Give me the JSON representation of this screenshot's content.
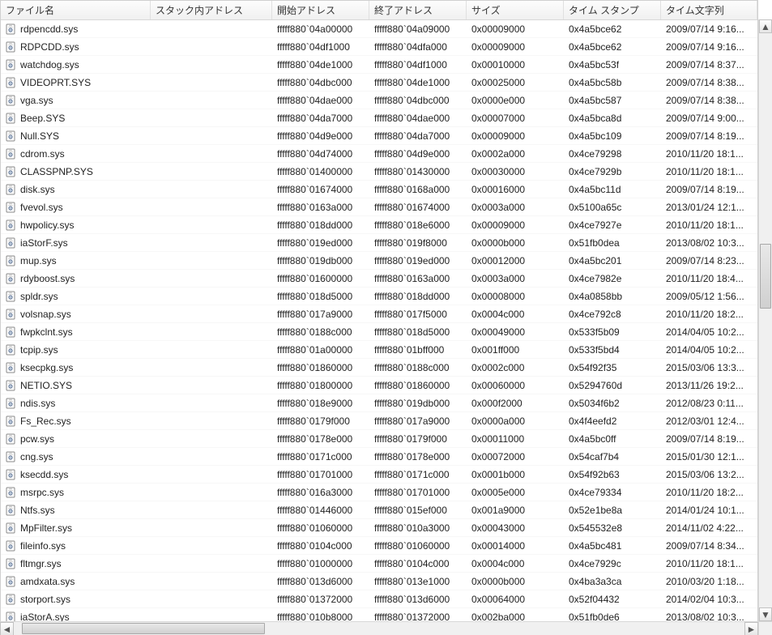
{
  "columns": [
    "ファイル名",
    "スタック内アドレス",
    "開始アドレス",
    "終了アドレス",
    "サイズ",
    "タイム スタンプ",
    "タイム文字列"
  ],
  "rows": [
    {
      "file": "rdpencdd.sys",
      "stack": "",
      "start": "fffff880`04a00000",
      "end": "fffff880`04a09000",
      "size": "0x00009000",
      "ts": "0x4a5bce62",
      "tstr": "2009/07/14 9:16..."
    },
    {
      "file": "RDPCDD.sys",
      "stack": "",
      "start": "fffff880`04df1000",
      "end": "fffff880`04dfa000",
      "size": "0x00009000",
      "ts": "0x4a5bce62",
      "tstr": "2009/07/14 9:16..."
    },
    {
      "file": "watchdog.sys",
      "stack": "",
      "start": "fffff880`04de1000",
      "end": "fffff880`04df1000",
      "size": "0x00010000",
      "ts": "0x4a5bc53f",
      "tstr": "2009/07/14 8:37..."
    },
    {
      "file": "VIDEOPRT.SYS",
      "stack": "",
      "start": "fffff880`04dbc000",
      "end": "fffff880`04de1000",
      "size": "0x00025000",
      "ts": "0x4a5bc58b",
      "tstr": "2009/07/14 8:38..."
    },
    {
      "file": "vga.sys",
      "stack": "",
      "start": "fffff880`04dae000",
      "end": "fffff880`04dbc000",
      "size": "0x0000e000",
      "ts": "0x4a5bc587",
      "tstr": "2009/07/14 8:38..."
    },
    {
      "file": "Beep.SYS",
      "stack": "",
      "start": "fffff880`04da7000",
      "end": "fffff880`04dae000",
      "size": "0x00007000",
      "ts": "0x4a5bca8d",
      "tstr": "2009/07/14 9:00..."
    },
    {
      "file": "Null.SYS",
      "stack": "",
      "start": "fffff880`04d9e000",
      "end": "fffff880`04da7000",
      "size": "0x00009000",
      "ts": "0x4a5bc109",
      "tstr": "2009/07/14 8:19..."
    },
    {
      "file": "cdrom.sys",
      "stack": "",
      "start": "fffff880`04d74000",
      "end": "fffff880`04d9e000",
      "size": "0x0002a000",
      "ts": "0x4ce79298",
      "tstr": "2010/11/20 18:1..."
    },
    {
      "file": "CLASSPNP.SYS",
      "stack": "",
      "start": "fffff880`01400000",
      "end": "fffff880`01430000",
      "size": "0x00030000",
      "ts": "0x4ce7929b",
      "tstr": "2010/11/20 18:1..."
    },
    {
      "file": "disk.sys",
      "stack": "",
      "start": "fffff880`01674000",
      "end": "fffff880`0168a000",
      "size": "0x00016000",
      "ts": "0x4a5bc11d",
      "tstr": "2009/07/14 8:19..."
    },
    {
      "file": "fvevol.sys",
      "stack": "",
      "start": "fffff880`0163a000",
      "end": "fffff880`01674000",
      "size": "0x0003a000",
      "ts": "0x5100a65c",
      "tstr": "2013/01/24 12:1..."
    },
    {
      "file": "hwpolicy.sys",
      "stack": "",
      "start": "fffff880`018dd000",
      "end": "fffff880`018e6000",
      "size": "0x00009000",
      "ts": "0x4ce7927e",
      "tstr": "2010/11/20 18:1..."
    },
    {
      "file": "iaStorF.sys",
      "stack": "",
      "start": "fffff880`019ed000",
      "end": "fffff880`019f8000",
      "size": "0x0000b000",
      "ts": "0x51fb0dea",
      "tstr": "2013/08/02 10:3..."
    },
    {
      "file": "mup.sys",
      "stack": "",
      "start": "fffff880`019db000",
      "end": "fffff880`019ed000",
      "size": "0x00012000",
      "ts": "0x4a5bc201",
      "tstr": "2009/07/14 8:23..."
    },
    {
      "file": "rdyboost.sys",
      "stack": "",
      "start": "fffff880`01600000",
      "end": "fffff880`0163a000",
      "size": "0x0003a000",
      "ts": "0x4ce7982e",
      "tstr": "2010/11/20 18:4..."
    },
    {
      "file": "spldr.sys",
      "stack": "",
      "start": "fffff880`018d5000",
      "end": "fffff880`018dd000",
      "size": "0x00008000",
      "ts": "0x4a0858bb",
      "tstr": "2009/05/12 1:56..."
    },
    {
      "file": "volsnap.sys",
      "stack": "",
      "start": "fffff880`017a9000",
      "end": "fffff880`017f5000",
      "size": "0x0004c000",
      "ts": "0x4ce792c8",
      "tstr": "2010/11/20 18:2..."
    },
    {
      "file": "fwpkclnt.sys",
      "stack": "",
      "start": "fffff880`0188c000",
      "end": "fffff880`018d5000",
      "size": "0x00049000",
      "ts": "0x533f5b09",
      "tstr": "2014/04/05 10:2..."
    },
    {
      "file": "tcpip.sys",
      "stack": "",
      "start": "fffff880`01a00000",
      "end": "fffff880`01bff000",
      "size": "0x001ff000",
      "ts": "0x533f5bd4",
      "tstr": "2014/04/05 10:2..."
    },
    {
      "file": "ksecpkg.sys",
      "stack": "",
      "start": "fffff880`01860000",
      "end": "fffff880`0188c000",
      "size": "0x0002c000",
      "ts": "0x54f92f35",
      "tstr": "2015/03/06 13:3..."
    },
    {
      "file": "NETIO.SYS",
      "stack": "",
      "start": "fffff880`01800000",
      "end": "fffff880`01860000",
      "size": "0x00060000",
      "ts": "0x5294760d",
      "tstr": "2013/11/26 19:2..."
    },
    {
      "file": "ndis.sys",
      "stack": "",
      "start": "fffff880`018e9000",
      "end": "fffff880`019db000",
      "size": "0x000f2000",
      "ts": "0x5034f6b2",
      "tstr": "2012/08/23 0:11..."
    },
    {
      "file": "Fs_Rec.sys",
      "stack": "",
      "start": "fffff880`0179f000",
      "end": "fffff880`017a9000",
      "size": "0x0000a000",
      "ts": "0x4f4eefd2",
      "tstr": "2012/03/01 12:4..."
    },
    {
      "file": "pcw.sys",
      "stack": "",
      "start": "fffff880`0178e000",
      "end": "fffff880`0179f000",
      "size": "0x00011000",
      "ts": "0x4a5bc0ff",
      "tstr": "2009/07/14 8:19..."
    },
    {
      "file": "cng.sys",
      "stack": "",
      "start": "fffff880`0171c000",
      "end": "fffff880`0178e000",
      "size": "0x00072000",
      "ts": "0x54caf7b4",
      "tstr": "2015/01/30 12:1..."
    },
    {
      "file": "ksecdd.sys",
      "stack": "",
      "start": "fffff880`01701000",
      "end": "fffff880`0171c000",
      "size": "0x0001b000",
      "ts": "0x54f92b63",
      "tstr": "2015/03/06 13:2..."
    },
    {
      "file": "msrpc.sys",
      "stack": "",
      "start": "fffff880`016a3000",
      "end": "fffff880`01701000",
      "size": "0x0005e000",
      "ts": "0x4ce79334",
      "tstr": "2010/11/20 18:2..."
    },
    {
      "file": "Ntfs.sys",
      "stack": "",
      "start": "fffff880`01446000",
      "end": "fffff880`015ef000",
      "size": "0x001a9000",
      "ts": "0x52e1be8a",
      "tstr": "2014/01/24 10:1..."
    },
    {
      "file": "MpFilter.sys",
      "stack": "",
      "start": "fffff880`01060000",
      "end": "fffff880`010a3000",
      "size": "0x00043000",
      "ts": "0x545532e8",
      "tstr": "2014/11/02 4:22..."
    },
    {
      "file": "fileinfo.sys",
      "stack": "",
      "start": "fffff880`0104c000",
      "end": "fffff880`01060000",
      "size": "0x00014000",
      "ts": "0x4a5bc481",
      "tstr": "2009/07/14 8:34..."
    },
    {
      "file": "fltmgr.sys",
      "stack": "",
      "start": "fffff880`01000000",
      "end": "fffff880`0104c000",
      "size": "0x0004c000",
      "ts": "0x4ce7929c",
      "tstr": "2010/11/20 18:1..."
    },
    {
      "file": "amdxata.sys",
      "stack": "",
      "start": "fffff880`013d6000",
      "end": "fffff880`013e1000",
      "size": "0x0000b000",
      "ts": "0x4ba3a3ca",
      "tstr": "2010/03/20 1:18..."
    },
    {
      "file": "storport.sys",
      "stack": "",
      "start": "fffff880`01372000",
      "end": "fffff880`013d6000",
      "size": "0x00064000",
      "ts": "0x52f04432",
      "tstr": "2014/02/04 10:3..."
    },
    {
      "file": "iaStorA.sys",
      "stack": "",
      "start": "fffff880`010b8000",
      "end": "fffff880`01372000",
      "size": "0x002ba000",
      "ts": "0x51fb0de6",
      "tstr": "2013/08/02 10:3..."
    }
  ]
}
